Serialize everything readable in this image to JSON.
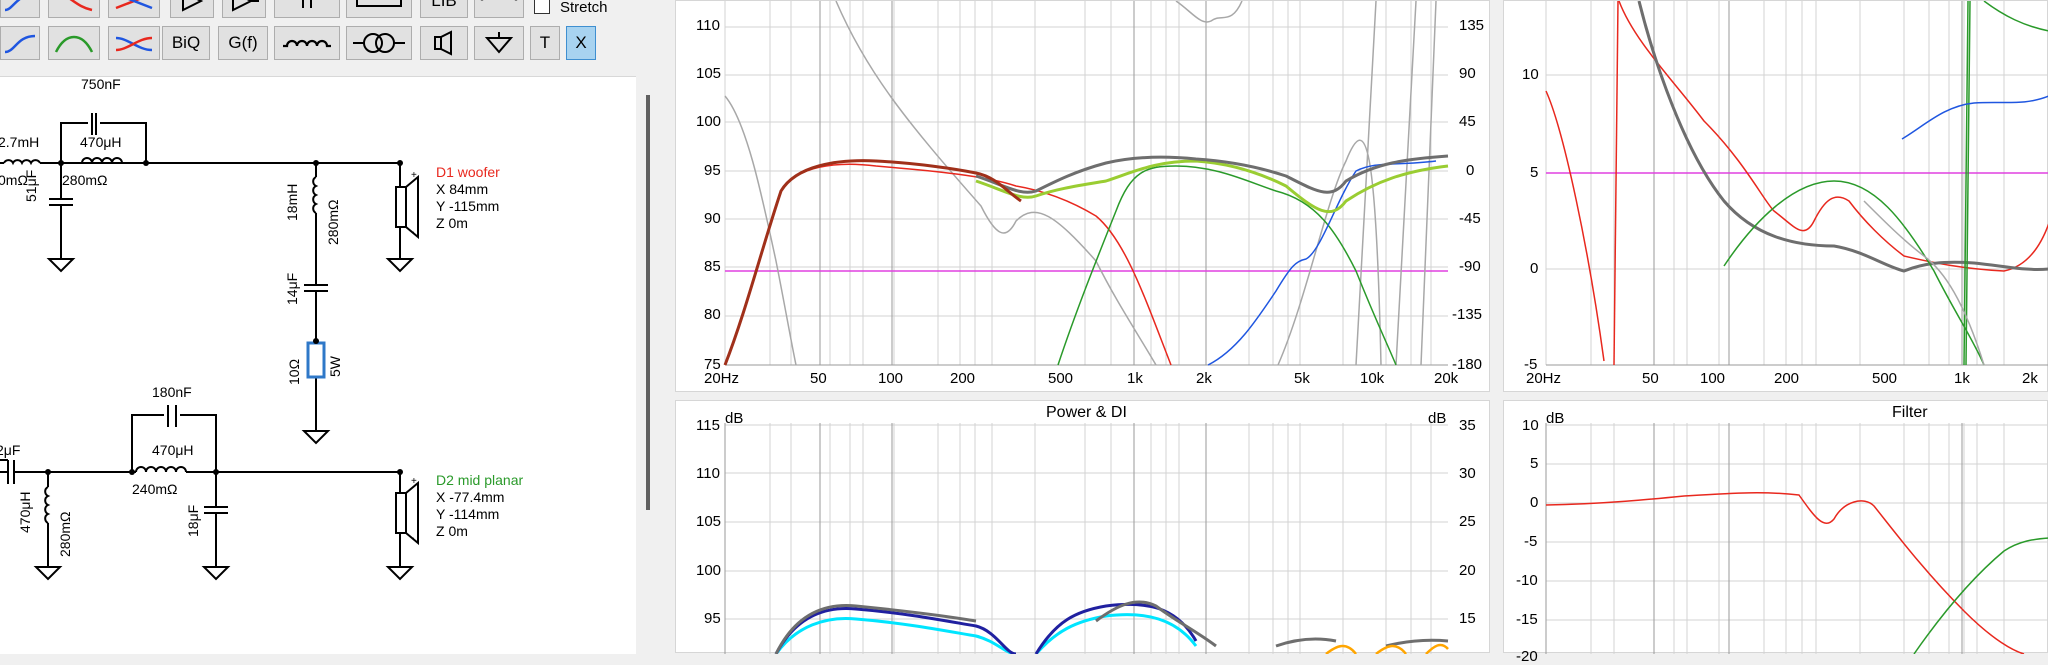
{
  "toolbar": {
    "lib_label": "LIB",
    "stretch_label": "Stretch",
    "biq_label": "BiQ",
    "gf_label": "G(f)",
    "t_label": "T",
    "x_label": "X"
  },
  "schematic": {
    "c_750nF": "750nF",
    "l_2_7mH": "2.7mH",
    "r_0mohm": "0mΩ",
    "l_470uH_1": "470μH",
    "r_280mohm_1": "280mΩ",
    "c_51uF": "51μF",
    "l_18mH": "18mH",
    "r_280mohm_2": "280mΩ",
    "c_14uF": "14μF",
    "r_10ohm": "10Ω",
    "r_5W": "5W",
    "d1_name": "D1 woofer",
    "d1_x": "X 84mm",
    "d1_y": "Y -115mm",
    "d1_z": "Z 0m",
    "c_180nF": "180nF",
    "l_470uH_2": "470μH",
    "r_240mohm": "240mΩ",
    "c_2uF": "2μF",
    "l_470uH_3": "470μH",
    "r_280mohm_3": "280mΩ",
    "c_18uF": "18μF",
    "d2_name": "D2 mid planar",
    "d2_x": "X -77.4mm",
    "d2_y": "Y -114mm",
    "d2_z": "Z 0m"
  },
  "colors": {
    "d1": "#e8281e",
    "d2": "#2a9a2a",
    "accent": "#3f8fd0",
    "reference_line": "#e040e0"
  },
  "panels": {
    "spl": {
      "y_ticks": [
        "110",
        "105",
        "100",
        "95",
        "90",
        "85",
        "80",
        "75"
      ],
      "y2_ticks": [
        "135",
        "90",
        "45",
        "0",
        "-45",
        "-90",
        "-135",
        "-180"
      ],
      "x_ticks": [
        "20Hz",
        "50",
        "100",
        "200",
        "500",
        "1k",
        "2k",
        "5k",
        "10k",
        "20k"
      ]
    },
    "impedance": {
      "y_ticks": [
        "10",
        "5",
        "0",
        "-5"
      ],
      "x_ticks": [
        "20Hz",
        "50",
        "100",
        "200",
        "500",
        "1k",
        "2k"
      ]
    },
    "power": {
      "title": "Power & DI",
      "unit_left": "dB",
      "unit_right": "dB",
      "y_ticks": [
        "115",
        "110",
        "105",
        "100",
        "95"
      ],
      "y2_ticks": [
        "35",
        "30",
        "25",
        "20",
        "15"
      ]
    },
    "filter": {
      "title": "Filter",
      "unit_left": "dB",
      "y_ticks": [
        "10",
        "5",
        "0",
        "-5",
        "-10",
        "-15",
        "-20"
      ]
    }
  }
}
